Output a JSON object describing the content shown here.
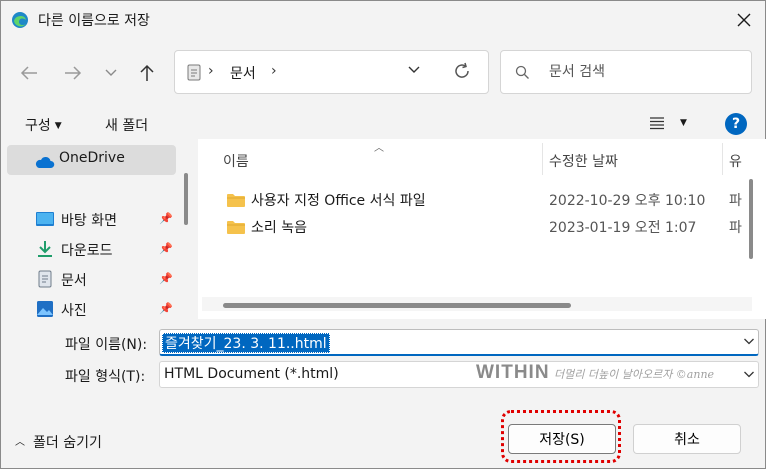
{
  "window": {
    "title": "다른 이름으로 저장"
  },
  "address_bar": {
    "crumbs": [
      "문서"
    ]
  },
  "search": {
    "placeholder": "문서 검색"
  },
  "toolbar": {
    "organize": "구성",
    "new_folder": "새 폴더",
    "help": "?"
  },
  "nav_pane": {
    "onedrive": "OneDrive",
    "items": [
      {
        "label": "바탕 화면",
        "icon": "desktop-icon"
      },
      {
        "label": "다운로드",
        "icon": "download-icon"
      },
      {
        "label": "문서",
        "icon": "documents-icon"
      },
      {
        "label": "사진",
        "icon": "pictures-icon"
      }
    ]
  },
  "file_list": {
    "columns": {
      "name": "이름",
      "date": "수정한 날짜",
      "type": "유"
    },
    "rows": [
      {
        "name": "사용자 지정 Office 서식 파일",
        "date": "2022-10-29 오후 10:10",
        "type": "파"
      },
      {
        "name": "소리 녹음",
        "date": "2023-01-19 오전 1:07",
        "type": "파"
      }
    ]
  },
  "form": {
    "filename_label": "파일 이름(N):",
    "filename_value": "즐겨찾기_23. 3. 11..html",
    "filetype_label": "파일 형식(T):",
    "filetype_value": "HTML Document (*.html)"
  },
  "watermark": {
    "brand": "WITHIN",
    "text": "더멀리 더높이 날아오르자 ©anne"
  },
  "footer": {
    "hide_folders": "폴더 숨기기",
    "save": "저장(S)",
    "cancel": "취소"
  },
  "colors": {
    "accent": "#0067c0",
    "highlight_border": "#e00000",
    "folder": "#f5c24c"
  }
}
